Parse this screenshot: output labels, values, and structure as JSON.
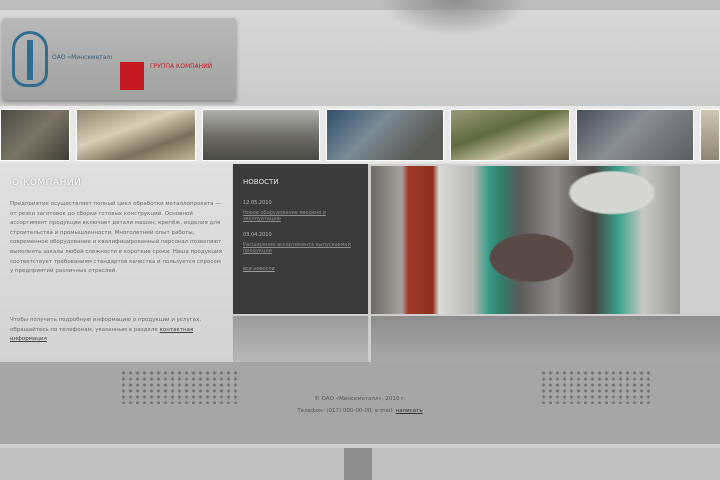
{
  "header": {
    "logo_text": "ОАО «Минскметалл»",
    "partner_text": "ГРУППА КОМПАНИЙ"
  },
  "gallery": {
    "thumbs": [
      "photo-1",
      "photo-2",
      "photo-3",
      "photo-4",
      "photo-5",
      "photo-6",
      "photo-7"
    ]
  },
  "intro": {
    "heading": "О КОМПАНИИ",
    "paragraph1": "Предприятие осуществляет полный цикл обработки металлопроката — от резки заготовок до сборки готовых конструкций. Основной ассортимент продукции включает детали машин, крепёж, изделия для строительства и промышленности. Многолетний опыт работы, современное оборудование и квалифицированный персонал позволяют выполнять заказы любой сложности в короткие сроки. Наша продукция соответствует требованиям стандартов качества и пользуется спросом у предприятий различных отраслей.",
    "paragraph2": "Чтобы получить подробную информацию о продукции и услугах, обращайтесь по телефонам, указанным в разделе",
    "paragraph2_link": "контактная информация"
  },
  "news": {
    "heading": "НОВОСТИ",
    "items": [
      {
        "date": "12.05.2010",
        "title": "Новое оборудование введено в эксплуатацию"
      },
      {
        "date": "03.04.2010",
        "title": "Расширение ассортимента выпускаемой продукции"
      }
    ],
    "all_link": "все новости"
  },
  "footer": {
    "copyright": "© ОАО «Минскметалл», 2010 г.",
    "contact_text": "Телефон: (017) 000-00-00, e-mail:",
    "contact_link": "написать"
  },
  "colors": {
    "news_background": "#3b3b3b",
    "logo_blue": "#2f6e8f",
    "partner_red": "#c51a24"
  }
}
